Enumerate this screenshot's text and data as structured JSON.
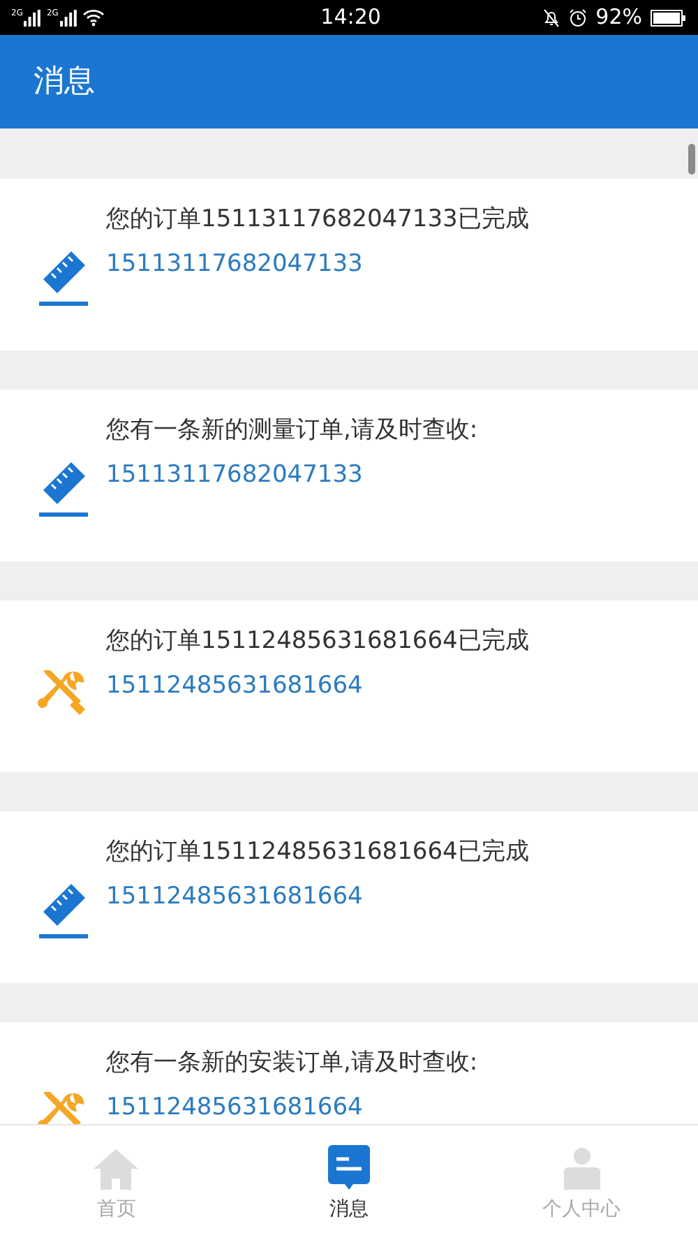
{
  "status_bar": {
    "signals": [
      "2G",
      "2G"
    ],
    "time": "14:20",
    "battery": "92%"
  },
  "header": {
    "title": "消息"
  },
  "messages": [
    {
      "kind": "ruler",
      "title": "您的订单15113117682047133已完成",
      "order": "15113117682047133"
    },
    {
      "kind": "ruler",
      "title": "您有一条新的测量订单,请及时查收:",
      "order": "15113117682047133"
    },
    {
      "kind": "tools",
      "title": "您的订单15112485631681664已完成",
      "order": "15112485631681664"
    },
    {
      "kind": "ruler",
      "title": "您的订单15112485631681664已完成",
      "order": "15112485631681664"
    },
    {
      "kind": "tools",
      "title": "您有一条新的安装订单,请及时查收:",
      "order": "15112485631681664"
    }
  ],
  "tab_bar": [
    {
      "kind": "home",
      "label": "首页",
      "selected": false
    },
    {
      "kind": "message",
      "label": "消息",
      "selected": true
    },
    {
      "kind": "person",
      "label": "个人中心",
      "selected": false
    }
  ]
}
